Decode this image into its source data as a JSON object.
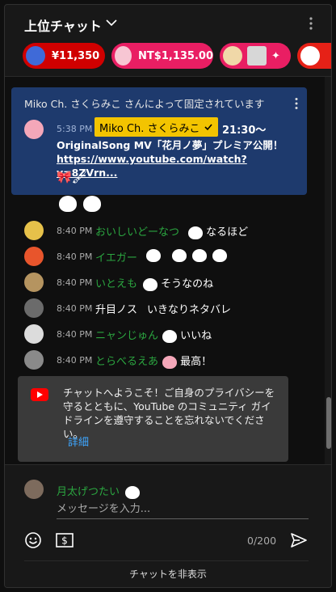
{
  "header": {
    "title": "上位チャット"
  },
  "superchats": [
    {
      "amount": "¥11,350",
      "color": "#d00000"
    },
    {
      "amount": "NT$1,135.00",
      "color": "#e91e63"
    },
    {
      "amount": "",
      "color": "#e91e63"
    },
    {
      "amount": "",
      "color": "#e62117"
    }
  ],
  "pinned": {
    "title": "Miko Ch. さくらみこ さんによって固定されています",
    "time": "5:38 PM",
    "author": "Miko Ch. さくらみこ",
    "text_start": "21:30〜",
    "line2_bold": "OriginalSong MV「花月ノ夢」プレミア公開！",
    "link": "https://www.youtube.com/watch?v=8ZVrn..."
  },
  "messages": [
    {
      "time": "8:40 PM",
      "author": "おいしいどーなつ",
      "text": "なるほど",
      "author_color": "#2ba640",
      "avatar_color": "#e6c14a"
    },
    {
      "time": "8:40 PM",
      "author": "イエガー",
      "text": "",
      "author_color": "#2ba640",
      "avatar_color": "#e8552c"
    },
    {
      "time": "8:40 PM",
      "author": "いとえも",
      "text": "そうなのね",
      "author_color": "#2ba640",
      "avatar_color": "#b59460"
    },
    {
      "time": "8:40 PM",
      "author": "升目ノス",
      "text": "いきなりネタバレ",
      "author_color": "#ffffff",
      "avatar_color": "#6b6b6b"
    },
    {
      "time": "8:40 PM",
      "author": "ニャンじゅん",
      "text": "いいね",
      "author_color": "#2ba640",
      "avatar_color": "#dcdcdc"
    },
    {
      "time": "8:40 PM",
      "author": "とらべるえあ",
      "text": "最高！",
      "author_color": "#2ba640",
      "avatar_color": "#8a8a8a"
    }
  ],
  "welcome": {
    "text": "チャットへようこそ！ご自身のプライバシーを守るとともに、YouTube のコミュニティ ガイドラインを遵守することを忘れないでください。",
    "link": "詳細"
  },
  "composer": {
    "username": "月太げつたい",
    "placeholder": "メッセージを入力...",
    "counter": "0/200"
  },
  "footer": {
    "hide_chat": "チャットを非表示"
  },
  "icons": {
    "header_menu": "kebab-vertical-icon",
    "dropdown": "chevron-down-icon",
    "verified": "check-icon",
    "emoji": "smiley-icon",
    "super_chat": "dollar-bill-icon",
    "send": "send-icon"
  }
}
